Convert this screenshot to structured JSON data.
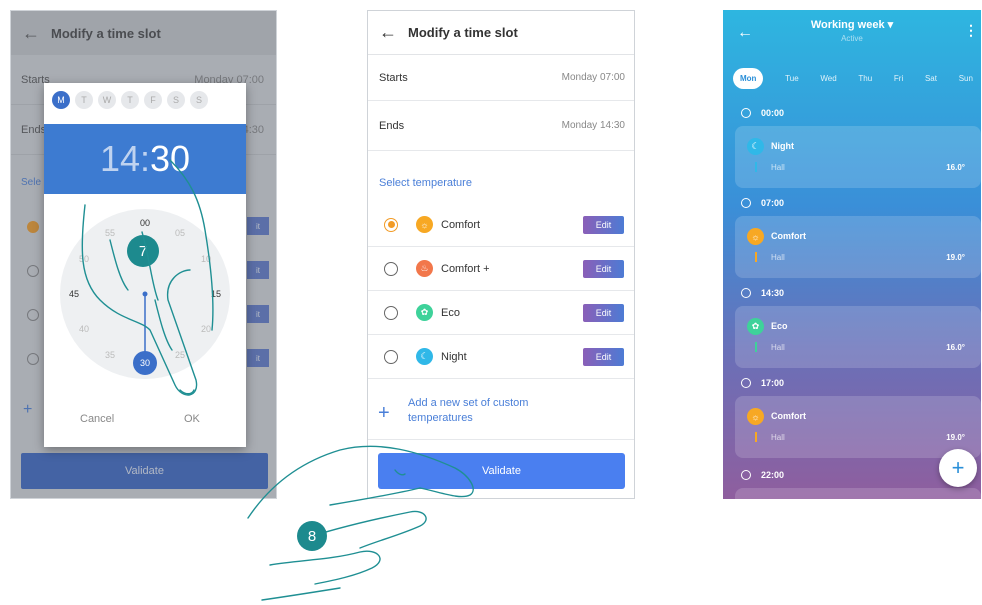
{
  "panel1": {
    "title": "Modify a time slot",
    "starts_label": "Starts",
    "starts_value": "Monday 07:00",
    "ends_label": "Ends",
    "ends_value": "Monday 14:30",
    "select_label": "Sele",
    "ghost_edit": "it",
    "validate": "Validate",
    "picker": {
      "days": [
        "M",
        "T",
        "W",
        "T",
        "F",
        "S",
        "S"
      ],
      "hour": "14",
      "sep": ":",
      "minute": "30",
      "clock": [
        "00",
        "05",
        "10",
        "15",
        "20",
        "25",
        "30",
        "35",
        "40",
        "45",
        "50",
        "55"
      ],
      "cancel": "Cancel",
      "ok": "OK"
    },
    "step_badge": "7"
  },
  "panel2": {
    "title": "Modify a time slot",
    "starts_label": "Starts",
    "starts_value": "Monday 07:00",
    "ends_label": "Ends",
    "ends_value": "Monday 14:30",
    "select_temperature": "Select temperature",
    "options": [
      {
        "name": "Comfort",
        "color": "#f7a823",
        "selected": true
      },
      {
        "name": "Comfort +",
        "color": "#f2774b",
        "selected": false
      },
      {
        "name": "Eco",
        "color": "#3ed29a",
        "selected": false
      },
      {
        "name": "Night",
        "color": "#30b8e8",
        "selected": false
      }
    ],
    "edit": "Edit",
    "add_custom": "Add a new set of custom temperatures",
    "validate": "Validate",
    "step_badge": "8"
  },
  "panel3": {
    "title": "Working week",
    "subtitle": "Active",
    "days": [
      "Mon",
      "Tue",
      "Wed",
      "Thu",
      "Fri",
      "Sat",
      "Sun"
    ],
    "slots": [
      {
        "time": "00:00",
        "name": "Night",
        "zone": "Hall",
        "temp": "16.0°",
        "color": "#30b8e8"
      },
      {
        "time": "07:00",
        "name": "Comfort",
        "zone": "Hall",
        "temp": "19.0°",
        "color": "#f7a823"
      },
      {
        "time": "14:30",
        "name": "Eco",
        "zone": "Hall",
        "temp": "16.0°",
        "color": "#3ed29a"
      },
      {
        "time": "17:00",
        "name": "Comfort",
        "zone": "Hall",
        "temp": "19.0°",
        "color": "#f7a823"
      },
      {
        "time": "22:00"
      }
    ],
    "fab": "+"
  }
}
